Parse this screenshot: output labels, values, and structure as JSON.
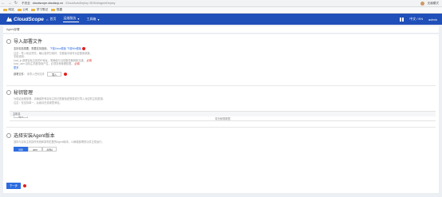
{
  "browser": {
    "back": "←",
    "forward": "→",
    "reload": "↻",
    "insecure_label": "不安全",
    "host": "cloudscope.cloudscp.cn",
    "path": "/CloudAutoDeploy /SDK/#/agentDeploy",
    "profile_label": "无痕模式"
  },
  "bookmarks": [
    {
      "label": "网站"
    },
    {
      "label": "公司"
    },
    {
      "label": "学习笔记"
    },
    {
      "label": "快捷"
    }
  ],
  "appbar": {
    "logo_text": "CloudScope",
    "nav": [
      {
        "label": "首页"
      },
      {
        "label": "运维服务"
      },
      {
        "label": "工具箱"
      }
    ],
    "lang": "中文 / EN",
    "user": "admin"
  },
  "breadcrumb": "Agent部署",
  "step1": {
    "title": "导入部署文件",
    "desc_prefix": "支持包括需要，需要支持选用。",
    "link1": "下载Linux模板",
    "link2": "下载Win模板",
    "lines": [
      "注意：导入前必须先，确认各项已填好，在模板中填写对应配置参数。",
      "字段说明：",
      "host_ip          部署目标主机的IP地址，需确保与当前服务器网络互通。",
      "host_user       目标主机登录用户名，必须具有管理权限。",
      "更多"
    ],
    "red_note1": "必填",
    "red_note2": "必填",
    "file_label": "部署文件:",
    "file_placeholder": "未导入任何文件",
    "import_btn": "导入"
  },
  "step2": {
    "title": "秘钥管理",
    "desc": "为保证远程部署，请确保所有目标主机已配置免密登录或已导入对应的主机密钥。",
    "note": "注意：仅支持单一，后续请在设置里添加。",
    "import_btn": "导入",
    "table_header": "主机名",
    "empty_text": "暂无秘钥数据"
  },
  "step3": {
    "title": "选择安装Agent版本",
    "desc": "选择与目标主机操作系统和架构匹配的Agent版本，以确保部署成功并正常运行。",
    "options": [
      {
        "label": "X86",
        "selected": true
      },
      {
        "label": "arm",
        "selected": false
      },
      {
        "label": "ARM",
        "selected": false
      }
    ]
  },
  "next_btn": "下一步",
  "colors": {
    "brand": "#1f4fb8",
    "primary": "#2d6cdf",
    "marker": "#e02020"
  }
}
